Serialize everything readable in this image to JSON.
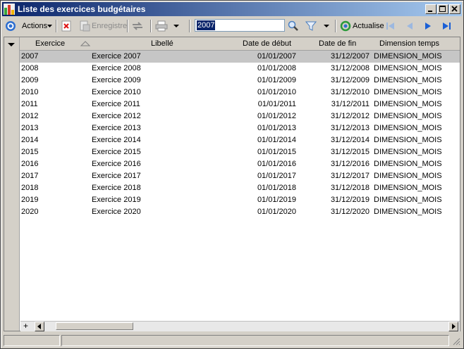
{
  "window": {
    "title": "Liste des exercices budgétaires"
  },
  "toolbar": {
    "actions_label": "Actions",
    "save_label": "Enregistre",
    "search_value": "2007",
    "refresh_label": "Actualise"
  },
  "grid": {
    "columns": [
      "Exercice",
      "Libellé",
      "Date de début",
      "Date de fin",
      "Dimension temps"
    ],
    "rows": [
      {
        "exercice": "2007",
        "libelle": "Exercice 2007",
        "debut": "01/01/2007",
        "fin": "31/12/2007",
        "dimension": "DIMENSION_MOIS"
      },
      {
        "exercice": "2008",
        "libelle": "Exercice 2008",
        "debut": "01/01/2008",
        "fin": "31/12/2008",
        "dimension": "DIMENSION_MOIS"
      },
      {
        "exercice": "2009",
        "libelle": "Exercice 2009",
        "debut": "01/01/2009",
        "fin": "31/12/2009",
        "dimension": "DIMENSION_MOIS"
      },
      {
        "exercice": "2010",
        "libelle": "Exercice 2010",
        "debut": "01/01/2010",
        "fin": "31/12/2010",
        "dimension": "DIMENSION_MOIS"
      },
      {
        "exercice": "2011",
        "libelle": "Exercice 2011",
        "debut": "01/01/2011",
        "fin": "31/12/2011",
        "dimension": "DIMENSION_MOIS"
      },
      {
        "exercice": "2012",
        "libelle": "Exercice 2012",
        "debut": "01/01/2012",
        "fin": "31/12/2012",
        "dimension": "DIMENSION_MOIS"
      },
      {
        "exercice": "2013",
        "libelle": "Exercice 2013",
        "debut": "01/01/2013",
        "fin": "31/12/2013",
        "dimension": "DIMENSION_MOIS"
      },
      {
        "exercice": "2014",
        "libelle": "Exercice 2014",
        "debut": "01/01/2014",
        "fin": "31/12/2014",
        "dimension": "DIMENSION_MOIS"
      },
      {
        "exercice": "2015",
        "libelle": "Exercice 2015",
        "debut": "01/01/2015",
        "fin": "31/12/2015",
        "dimension": "DIMENSION_MOIS"
      },
      {
        "exercice": "2016",
        "libelle": "Exercice 2016",
        "debut": "01/01/2016",
        "fin": "31/12/2016",
        "dimension": "DIMENSION_MOIS"
      },
      {
        "exercice": "2017",
        "libelle": "Exercice 2017",
        "debut": "01/01/2017",
        "fin": "31/12/2017",
        "dimension": "DIMENSION_MOIS"
      },
      {
        "exercice": "2018",
        "libelle": "Exercice 2018",
        "debut": "01/01/2018",
        "fin": "31/12/2018",
        "dimension": "DIMENSION_MOIS"
      },
      {
        "exercice": "2019",
        "libelle": "Exercice 2019",
        "debut": "01/01/2019",
        "fin": "31/12/2019",
        "dimension": "DIMENSION_MOIS"
      },
      {
        "exercice": "2020",
        "libelle": "Exercice 2020",
        "debut": "01/01/2020",
        "fin": "31/12/2020",
        "dimension": "DIMENSION_MOIS"
      }
    ]
  },
  "icons": {
    "actions": "circle-target-icon",
    "delete": "delete-red-x-icon",
    "save": "save-document-icon",
    "sync": "sync-arrows-icon",
    "print": "printer-icon",
    "search": "magnifier-icon",
    "filter": "funnel-icon",
    "refresh": "refresh-green-icon",
    "nav_first": "first-record-icon",
    "nav_prev": "previous-record-icon",
    "nav_next": "next-record-icon",
    "nav_last": "last-record-icon"
  },
  "colors": {
    "titlebar_start": "#0a246a",
    "titlebar_end": "#a6caf0",
    "selected_row": "#c6c6c6",
    "nav_blue": "#1a5fd6"
  }
}
